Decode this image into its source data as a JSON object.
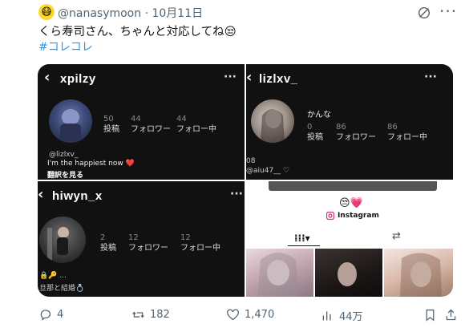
{
  "tweet": {
    "avatar_emoji": "😷",
    "handle": "@nanasymoon",
    "separator": "·",
    "date": "10月11日",
    "text": "くら寿司さん、ちゃんと対応してね😒",
    "hashtag": "#コレコレ"
  },
  "panels": {
    "p1": {
      "username": "xpilzy",
      "stats": [
        {
          "n": "50",
          "l": "投稿"
        },
        {
          "n": "44",
          "l": "フォロワー"
        },
        {
          "n": "44",
          "l": "フォロー中"
        }
      ],
      "mention": "@lizlxv_",
      "bio": "I'm the happiest now ❤️",
      "translate": "翻訳を見る"
    },
    "p2": {
      "username": "lizlxv_",
      "name": "かんな",
      "stats": [
        {
          "n": "0",
          "l": "投稿"
        },
        {
          "n": "86",
          "l": "フォロワー"
        },
        {
          "n": "86",
          "l": "フォロー中"
        }
      ],
      "bio1": "08",
      "bio2": "@aiu47__ ♡"
    },
    "p3": {
      "username": "hiwyn_x",
      "stats": [
        {
          "n": "2",
          "l": "投稿"
        },
        {
          "n": "12",
          "l": "フォロワー"
        },
        {
          "n": "12",
          "l": "フォロー中"
        }
      ],
      "bio1": "🔒🔑 ...",
      "bio2": "旦那と結婚💍"
    },
    "p4": {
      "emoji": "😒💗",
      "instagram": "Instagram"
    }
  },
  "actions": {
    "replies": "4",
    "retweets": "182",
    "likes": "1,470",
    "views": "44万"
  },
  "colors": {
    "link": "#1d9bf0",
    "muted": "#536471",
    "panel_bg": "#111111"
  }
}
